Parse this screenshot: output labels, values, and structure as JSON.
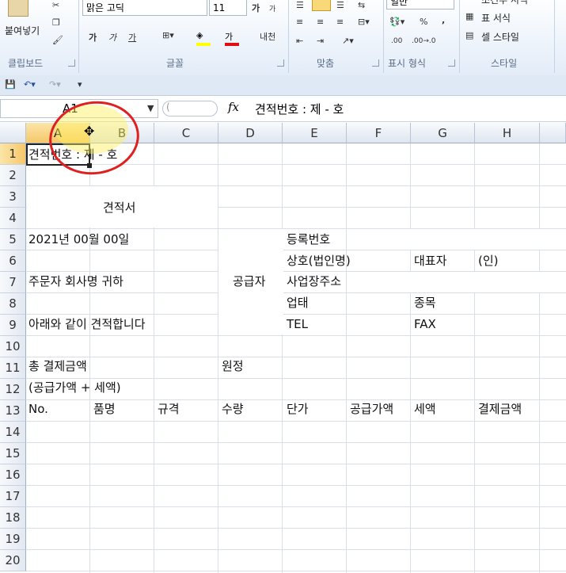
{
  "ribbon": {
    "clipboard": {
      "paste_label": "붙여넣기",
      "group_label": "클립보드"
    },
    "font": {
      "font_name": "맑은 고딕",
      "font_size": "11",
      "bold": "가",
      "italic": "가",
      "underline": "가",
      "grow": "가",
      "shrink": "가",
      "phonetic": "내천",
      "group_label": "글꼴"
    },
    "alignment": {
      "group_label": "맞춤"
    },
    "number": {
      "format_value": "일반",
      "percent": "%",
      "comma": ",",
      "inc_decimal": ".00",
      "group_label": "표시 형식"
    },
    "styles": {
      "cond_format": "조건부 서식",
      "table_format": "표 서식",
      "cell_style": "셀 스타일",
      "group_label": "스타일"
    }
  },
  "formula_bar": {
    "name_box": "A1",
    "fx": "fx",
    "formula": "견적번호 : 제  -  호"
  },
  "columns": [
    "A",
    "B",
    "C",
    "D",
    "E",
    "F",
    "G",
    "H"
  ],
  "rows": [
    "1",
    "2",
    "3",
    "4",
    "5",
    "6",
    "7",
    "8",
    "9",
    "10",
    "11",
    "12",
    "13",
    "14",
    "15",
    "16",
    "17",
    "18",
    "19",
    "20"
  ],
  "cells": {
    "a1": "견적번호 : 제  -  호",
    "title": "견적서",
    "date": "2021년     00월     00일",
    "reg_no": "등록번호",
    "company_name": "상호(법인명)",
    "ceo": "대표자",
    "seal": "(인)",
    "customer": "주문자 회사명     귀하",
    "supplier": "공급자",
    "address": "사업장주소",
    "business_type": "업태",
    "category": "종목",
    "quote_text": "아래와 같이 견적합니다",
    "tel": "TEL",
    "fax": "FAX",
    "total_label": "총 결제금액",
    "won": "원정",
    "total_note": "(공급가액 + 세액)",
    "h_no": "No.",
    "h_item": "품명",
    "h_spec": "규격",
    "h_qty": "수량",
    "h_price": "단가",
    "h_supply": "공급가액",
    "h_tax": "세액",
    "h_total": "결제금액"
  }
}
